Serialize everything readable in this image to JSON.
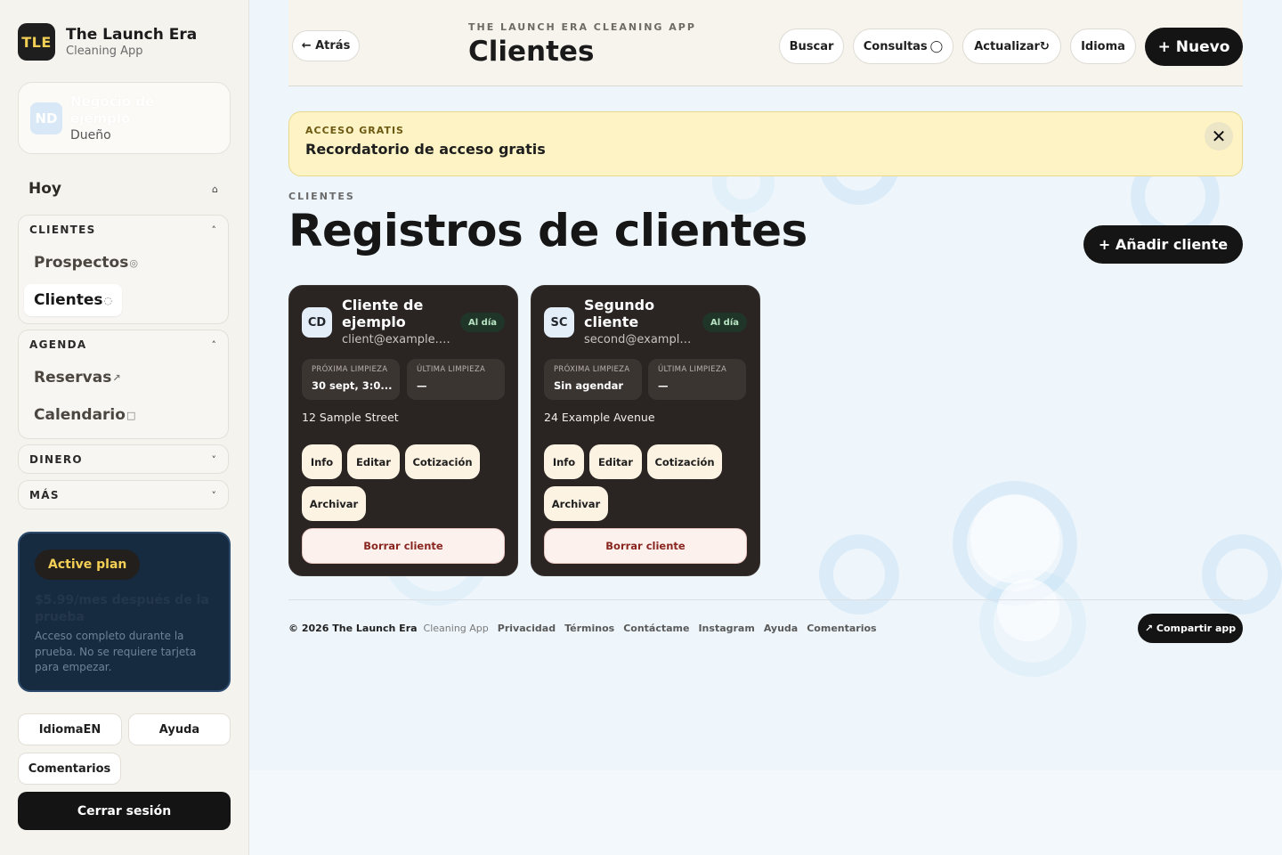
{
  "brand": {
    "logo": "TLE",
    "name": "The Launch Era",
    "subtitle": "Cleaning App"
  },
  "business": {
    "initials": "ND",
    "name": "Negocio de ejemplo",
    "role": "Dueño"
  },
  "sidebar": {
    "today": {
      "label": "Hoy",
      "icon": "home-icon",
      "glyph": "⌂"
    },
    "groups": [
      {
        "label": "CLIENTES",
        "expanded": true,
        "chevron": "˄",
        "items": [
          {
            "label": "Prospectos",
            "icon": "target-icon",
            "glyph": "◎",
            "active": false
          },
          {
            "label": "Clientes",
            "icon": "circle-dotted-icon",
            "glyph": "◌",
            "active": true
          }
        ]
      },
      {
        "label": "AGENDA",
        "expanded": true,
        "chevron": "˄",
        "items": [
          {
            "label": "Reservas",
            "icon": "arrow-up-right-icon",
            "glyph": "↗",
            "active": false
          },
          {
            "label": "Calendario",
            "icon": "square-icon",
            "glyph": "□",
            "active": false
          }
        ]
      },
      {
        "label": "DINERO",
        "expanded": false,
        "chevron": "˅"
      },
      {
        "label": "MÁS",
        "expanded": false,
        "chevron": "˅"
      }
    ],
    "plan": {
      "badge": "Active plan",
      "price": "$5.99/mes después de la prueba",
      "description": "Acceso completo durante la prueba. No se requiere tarjeta para empezar."
    },
    "language_button": "IdiomaEN",
    "help_button": "Ayuda",
    "feedback_button": "Comentarios",
    "logout_button": "Cerrar sesión"
  },
  "topbar": {
    "back": "← Atrás",
    "kicker": "THE LAUNCH ERA CLEANING APP",
    "title": "Clientes",
    "search": "Buscar",
    "inquiries": "Consultas",
    "inquiries_glyph": "◯",
    "refresh": "Actualizar",
    "refresh_glyph": "↻",
    "language": "Idioma",
    "new": "+ Nuevo"
  },
  "banner": {
    "kicker": "ACCESO GRATIS",
    "title": "Recordatorio de acceso gratis",
    "close": "✕"
  },
  "section": {
    "kicker": "CLIENTES",
    "title": "Registros de clientes",
    "add_button": "+ Añadir cliente"
  },
  "clients": [
    {
      "initials": "CD",
      "name": "Cliente de ejemplo",
      "email": "client@example.c...",
      "status": "Al día",
      "next_label": "PRÓXIMA LIMPIEZA",
      "next_value": "30 sept, 3:0...",
      "last_label": "ÚLTIMA LIMPIEZA",
      "last_value": "—",
      "address": "12 Sample Street",
      "actions": {
        "info": "Info",
        "edit": "Editar",
        "quote": "Cotización",
        "archive": "Archivar",
        "delete": "Borrar cliente"
      }
    },
    {
      "initials": "SC",
      "name": "Segundo cliente",
      "email": "second@example....",
      "status": "Al día",
      "next_label": "PRÓXIMA LIMPIEZA",
      "next_value": "Sin agendar",
      "last_label": "ÚLTIMA LIMPIEZA",
      "last_value": "—",
      "address": "24 Example Avenue",
      "actions": {
        "info": "Info",
        "edit": "Editar",
        "quote": "Cotización",
        "archive": "Archivar",
        "delete": "Borrar cliente"
      }
    }
  ],
  "footer": {
    "copyright": "© 2026 The Launch Era",
    "sub": "Cleaning App",
    "links": [
      "Privacidad",
      "Términos",
      "Contáctame",
      "Instagram",
      "Ayuda",
      "Comentarios"
    ],
    "share": "↗ Compartir app"
  },
  "colors": {
    "accent_yellow": "#f3cf55",
    "dark": "#141414",
    "card_bg": "#2a2523",
    "banner_bg": "#fdf3c4",
    "plan_bg": "#162a40",
    "status_green": "#b7e4c3",
    "danger": "#8a2620"
  }
}
